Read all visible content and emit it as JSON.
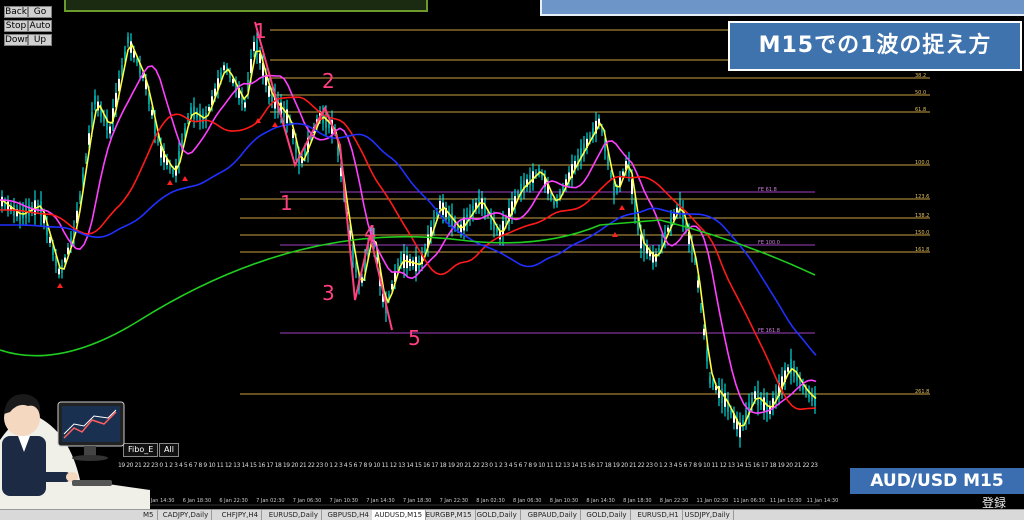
{
  "controls": [
    "Back",
    "Go",
    "Stop",
    "Auto",
    "Down",
    "Up"
  ],
  "title": "M15での1波の捉え方",
  "symbol": "AUD/USD M15",
  "register": "登録",
  "buttons": {
    "fibo": "Fibo_E",
    "all": "All"
  },
  "fib_labels": [
    "38.2",
    "50.0",
    "61.8",
    "100.0",
    "123.6",
    "138.2",
    "150.0",
    "161.8",
    "261.8"
  ],
  "fib_pink_labels": [
    "FE 61.8",
    "FE 100.0",
    "FE 161.8"
  ],
  "annotations": [
    "1",
    "2",
    "1",
    "3",
    "4",
    "5"
  ],
  "hour_ticks": "19 20 21 22 23 0 1 2 3 4 5 6 7 8 9 10 11 12 13 14 15 16 17 18 19 20 21 22 23 0 1 2 3 4 5 6 7 8 9 10 11 12 13 14 15 16 17 18 19 20 21 22 23 0 1 2 3 4 5 6 7 8 9 10 11 12 13 14 15 16 17 18 19 20 21 22 23 0 1 2 3 4 5 6 7 8 9 10 11 12 13 14 15 16 17 18 19 20 21 22 23",
  "date_ticks": [
    "6 Jan 14:30",
    "6 Jan 18:30",
    "6 Jan 22:30",
    "7 Jan 02:30",
    "7 Jan 06:30",
    "7 Jan 10:30",
    "7 Jan 14:30",
    "7 Jan 18:30",
    "7 Jan 22:30",
    "8 Jan 02:30",
    "8 Jan 06:30",
    "8 Jan 10:30",
    "8 Jan 14:30",
    "8 Jan 18:30",
    "8 Jan 22:30",
    "11 Jan 02:30",
    "11 Jan 06:30",
    "11 Jan 10:30",
    "11 Jan 14:30"
  ],
  "tabs": [
    "M5",
    "CADJPY,Daily",
    "CHFJPY,H4",
    "EURUSD,Daily",
    "GBPUSD,H4",
    "AUDUSD,M15",
    "EURGBP,M15",
    "GOLD,Daily",
    "GBPAUD,Daily",
    "GOLD,Daily",
    "EURUSD,H1",
    "USDJPY,Daily"
  ],
  "active_tab": "AUDUSD,M15",
  "colors": {
    "background": "#000000",
    "price": "#ffff40",
    "ma_fast": "#ff40ff",
    "ma_mid": "#ff1a1a",
    "ma_slow": "#2030ff",
    "ma_long": "#20cc20",
    "fib_line": "#c8a040",
    "fe_line": "#a040c0",
    "candle": "#00ffff",
    "ink": "#ff4080"
  }
}
